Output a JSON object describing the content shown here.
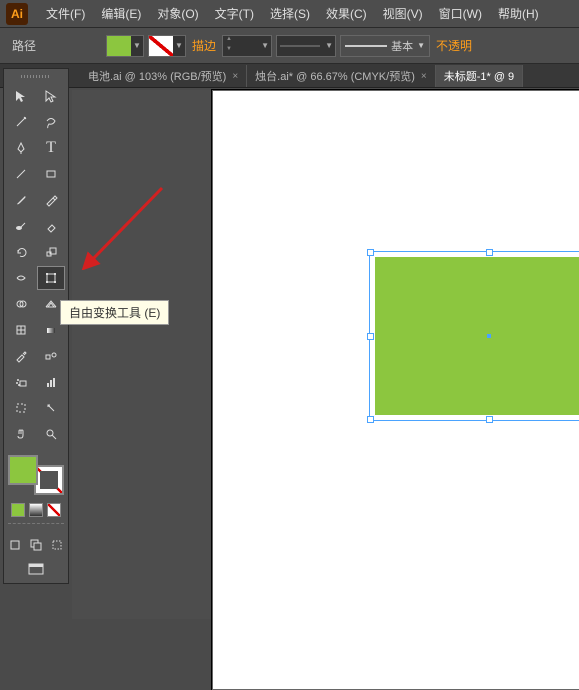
{
  "app": {
    "logo_text": "Ai"
  },
  "menu": {
    "file": "文件(F)",
    "edit": "编辑(E)",
    "object": "对象(O)",
    "type": "文字(T)",
    "select": "选择(S)",
    "effect": "效果(C)",
    "view": "视图(V)",
    "window": "窗口(W)",
    "help": "帮助(H)"
  },
  "control": {
    "mode_label": "路径",
    "fill_color": "#8cc63f",
    "stroke_none": true,
    "stroke_label": "描边",
    "stroke_weight": "",
    "line_label": "基本",
    "opacity_label": "不透明"
  },
  "tabs": [
    {
      "label": "电池.ai @ 103% (RGB/预览)",
      "active": false
    },
    {
      "label": "烛台.ai* @ 66.67% (CMYK/预览)",
      "active": false
    },
    {
      "label": "未标题-1* @ 9",
      "active": true
    }
  ],
  "tooltip": {
    "text": "自由变换工具 (E)"
  },
  "tools": {
    "row1": [
      "selection",
      "direct-selection"
    ],
    "row2": [
      "magic-wand",
      "lasso"
    ],
    "row3": [
      "pen",
      "type"
    ],
    "row4": [
      "line",
      "rectangle"
    ],
    "row5": [
      "paintbrush",
      "pencil"
    ],
    "row6": [
      "blob-brush",
      "eraser"
    ],
    "row7": [
      "rotate",
      "scale"
    ],
    "row8": [
      "width",
      "free-transform"
    ],
    "row9": [
      "shape-builder",
      "perspective"
    ],
    "row10": [
      "mesh",
      "gradient"
    ],
    "row11": [
      "eyedropper",
      "blend"
    ],
    "row12": [
      "symbol-sprayer",
      "column-graph"
    ],
    "row13": [
      "artboard",
      "slice"
    ],
    "row14": [
      "hand",
      "zoom"
    ]
  },
  "colors": {
    "fill": "#8cc63f",
    "stroke": "none",
    "mini": [
      "#8cc63f",
      "#ffffff",
      "none"
    ]
  },
  "canvas": {
    "shape_fill": "#8cc63f"
  }
}
